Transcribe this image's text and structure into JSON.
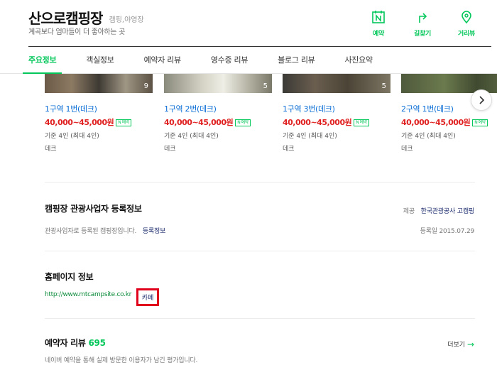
{
  "header": {
    "title": "산으로캠핑장",
    "category": "캠핑,야영장",
    "subtitle": "계곡보다 엄마들이 더 좋아하는 곳",
    "actions": [
      {
        "label": "예약",
        "icon": "calendar-n-icon"
      },
      {
        "label": "길찾기",
        "icon": "directions-icon"
      },
      {
        "label": "거리뷰",
        "icon": "pin-icon"
      }
    ]
  },
  "tabs": [
    "주요정보",
    "객실정보",
    "예약자 리뷰",
    "영수증 리뷰",
    "블로그 리뷰",
    "사진요약"
  ],
  "rooms": [
    {
      "count": "9",
      "name": "1구역 1번(데크)",
      "price": "40,000~45,000원",
      "badge": "N 예약",
      "capacity": "기준 4인 (최대 4인)",
      "type": "데크"
    },
    {
      "count": "5",
      "name": "1구역 2번(데크)",
      "price": "40,000~45,000원",
      "badge": "N 예약",
      "capacity": "기준 4인 (최대 4인)",
      "type": "데크"
    },
    {
      "count": "5",
      "name": "1구역 3번(데크)",
      "price": "40,000~45,000원",
      "badge": "N 예약",
      "capacity": "기준 4인 (최대 4인)",
      "type": "데크"
    },
    {
      "count": "",
      "name": "2구역 1번(데크)",
      "price": "40,000~45,000원",
      "badge": "N 예약",
      "capacity": "기준 4인 (최대 4인)",
      "type": "데크"
    }
  ],
  "registration": {
    "title": "캠핑장 관광사업자 등록정보",
    "provider_label": "제공",
    "provider": "한국관광공사 고캠핑",
    "desc": "관광사업자로 등록된 캠핑장입니다.",
    "desc_link": "등록정보",
    "date": "등록일 2015.07.29"
  },
  "homepage": {
    "title": "홈페이지 정보",
    "url": "http://www.mtcampsite.co.kr",
    "cafe": "카페"
  },
  "reviews": {
    "title": "예약자 리뷰",
    "count": "695",
    "desc": "네이버 예약을 통해 실제 방문한 이용자가 남긴 평가입니다.",
    "more": "더보기"
  },
  "colors": {
    "accent": "#03c75a",
    "price": "#e02020",
    "room_link": "#0a6dd6",
    "highlight": "#e0001b"
  }
}
